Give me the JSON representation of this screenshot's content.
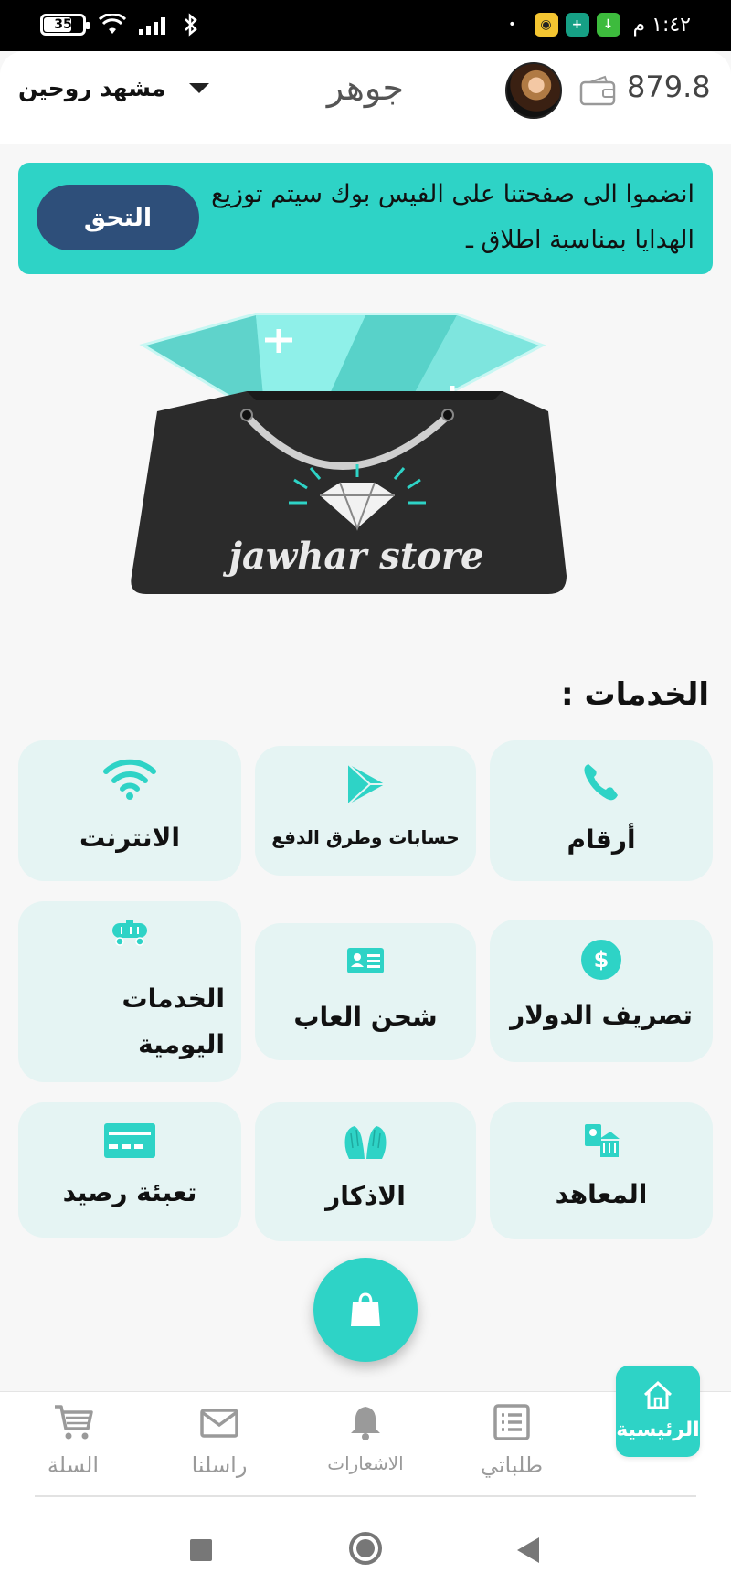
{
  "status_bar": {
    "battery": "35",
    "time": "١:٤٢ م"
  },
  "header": {
    "user_name": "مشهد روحين",
    "app_title": "جوهر",
    "balance": "879.8"
  },
  "banner": {
    "text": "انضموا الى صفحتنا على الفيس بوك سيتم توزيع الهدايا بمناسبة اطلاق ـ",
    "button": "التحق"
  },
  "logo": {
    "text": "jawhar store"
  },
  "services": {
    "title": "الخدمات :",
    "items": [
      {
        "label": "أرقام",
        "icon": "phone-icon"
      },
      {
        "label": "حسابات وطرق الدفع",
        "icon": "play-store-icon"
      },
      {
        "label": "الانترنت",
        "icon": "wifi-icon"
      },
      {
        "label": "تصريف الدولار",
        "icon": "dollar-icon"
      },
      {
        "label": "شحن العاب",
        "icon": "id-card-icon"
      },
      {
        "label": "الخدمات اليومية",
        "icon": "tanker-truck-icon"
      },
      {
        "label": "المعاهد",
        "icon": "institute-icon"
      },
      {
        "label": "الاذكار",
        "icon": "praying-hands-icon"
      },
      {
        "label": "تعبئة رصيد",
        "icon": "credit-card-icon"
      }
    ]
  },
  "bottom_nav": {
    "items": [
      {
        "label": "الرئيسية",
        "icon": "home-icon",
        "active": true
      },
      {
        "label": "طلباتي",
        "icon": "orders-icon"
      },
      {
        "label": "الاشعارات",
        "icon": "bell-icon"
      },
      {
        "label": "راسلنا",
        "icon": "mail-icon"
      },
      {
        "label": "السلة",
        "icon": "cart-icon"
      }
    ]
  },
  "colors": {
    "accent": "#2ed3c6",
    "banner_button": "#2e4f7a",
    "card_bg": "#e5f4f3"
  }
}
